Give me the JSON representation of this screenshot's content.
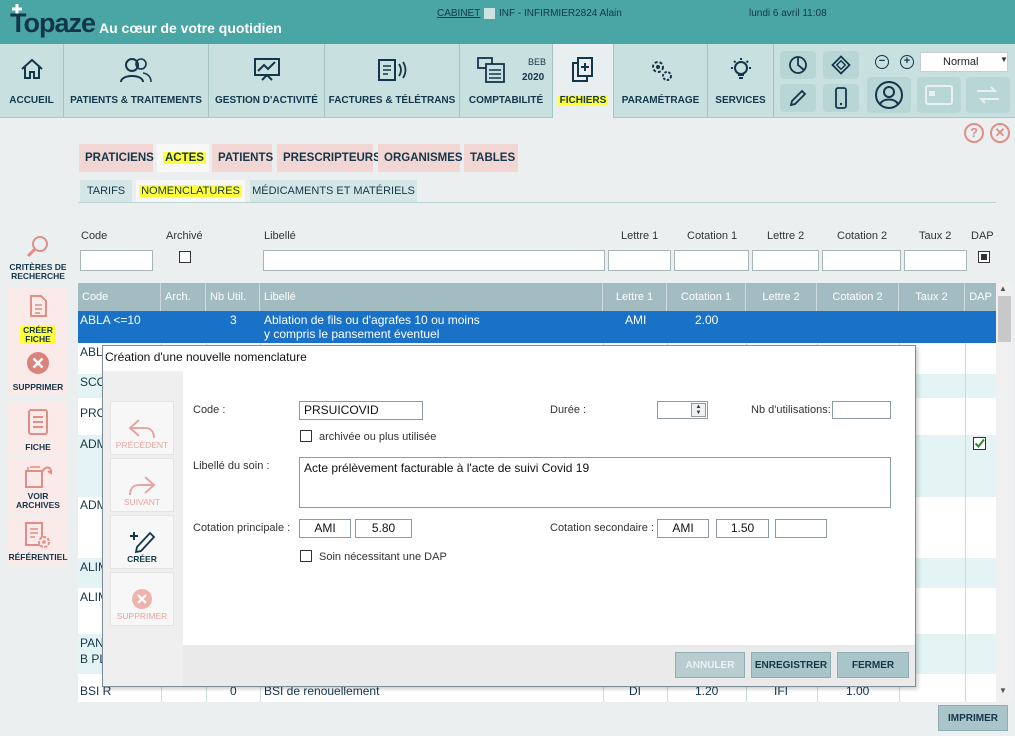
{
  "header": {
    "logo": "Topaze",
    "tagline": "Au cœur de votre quotidien",
    "cabinet": "CABINET",
    "user": "INF - INFIRMIER2824 Alain",
    "datetime": "lundi 6 avril 11:08"
  },
  "toolbar": {
    "items": [
      {
        "label": "ACCUEIL",
        "icon": "home-icon"
      },
      {
        "label": "PATIENTS & TRAITEMENTS",
        "icon": "users-icon"
      },
      {
        "label": "GESTION D'ACTIVITÉ",
        "icon": "chart-icon"
      },
      {
        "label": "FACTURES & TÉLÉTRANS",
        "icon": "invoice-icon"
      },
      {
        "label": "COMPTABILITÉ",
        "icon": "calculator-icon",
        "badge_top": "BEB",
        "badge_bottom": "2020"
      },
      {
        "label": "FICHIERS",
        "icon": "files-icon"
      },
      {
        "label": "PARAMÉTRAGE",
        "icon": "gears-icon"
      },
      {
        "label": "SERVICES",
        "icon": "lightbulb-icon"
      }
    ],
    "zoom_value": "Normal"
  },
  "sidebar": {
    "items": [
      {
        "label": "CRITÈRES DE RECHERCHE",
        "icon": "search-icon"
      },
      {
        "label": "CRÉER FICHE",
        "icon": "new-file-icon"
      },
      {
        "label": "SUPPRIMER",
        "icon": "delete-icon"
      },
      {
        "label": "FICHE",
        "icon": "file-icon"
      },
      {
        "label": "VOIR ARCHIVES",
        "icon": "archive-icon"
      },
      {
        "label": "RÉFÉRENTIEL",
        "icon": "referential-icon"
      }
    ]
  },
  "tabs": [
    "PRATICIENS",
    "ACTES",
    "PATIENTS",
    "PRESCRIPTEURS",
    "ORGANISMES",
    "TABLES"
  ],
  "subtabs": [
    "TARIFS",
    "NOMENCLATURES",
    "MÉDICAMENTS ET MATÉRIELS"
  ],
  "filters": {
    "code": "Code",
    "archived": "Archivé",
    "label": "Libellé",
    "letter1": "Lettre 1",
    "quote1": "Cotation 1",
    "letter2": "Lettre 2",
    "quote2": "Cotation 2",
    "rate2": "Taux 2",
    "dap": "DAP"
  },
  "table": {
    "columns": [
      "Code",
      "Arch.",
      "Nb Util.",
      "Libellé",
      "Lettre 1",
      "Cotation 1",
      "Lettre 2",
      "Cotation 2",
      "Taux 2",
      "DAP"
    ],
    "rows": [
      {
        "code": "ABLA <=10",
        "nb": "3",
        "label1": "Ablation de fils ou d'agrafes 10 ou moins",
        "label2": "y compris le pansement éventuel",
        "l1": "AMI",
        "c1": "2.00"
      },
      {
        "code": "ABL"
      },
      {
        "code": "SCO"
      },
      {
        "code": "PRO"
      },
      {
        "code": "ADM"
      },
      {
        "code": "ADM"
      },
      {
        "code": "ALIM"
      },
      {
        "code": "ALIM"
      },
      {
        "code": "PAN"
      },
      {
        "code": "B PL"
      },
      {
        "code": "BSI R",
        "nb": "0",
        "label1": "BSI de renouellement",
        "l1": "DI",
        "c1": "1.20",
        "l2": "IFI",
        "c2": "1.00"
      }
    ]
  },
  "dialog": {
    "title": "Création d'une nouvelle nomenclature",
    "side": [
      "PRÉCÉDENT",
      "SUIVANT",
      "CRÉER",
      "SUPPRIMER"
    ],
    "code_label": "Code :",
    "code_value": "PRSUICOVID",
    "duration_label": "Durée :",
    "usage_label": "Nb d'utilisations:",
    "archived_label": "archivée ou plus utilisée",
    "care_label": "Libellé du soin :",
    "care_value": "Acte prélèvement facturable à l'acte de suivi Covid 19",
    "main_quote_label": "Cotation principale :",
    "main_letter": "AMI",
    "main_value": "5.80",
    "second_quote_label": "Cotation secondaire :",
    "second_letter": "AMI",
    "second_value": "1.50",
    "dap_label": "Soin nécessitant une DAP",
    "buttons": {
      "cancel": "ANNULER",
      "save": "ENREGISTRER",
      "close": "FERMER"
    }
  },
  "print": "IMPRIMER"
}
